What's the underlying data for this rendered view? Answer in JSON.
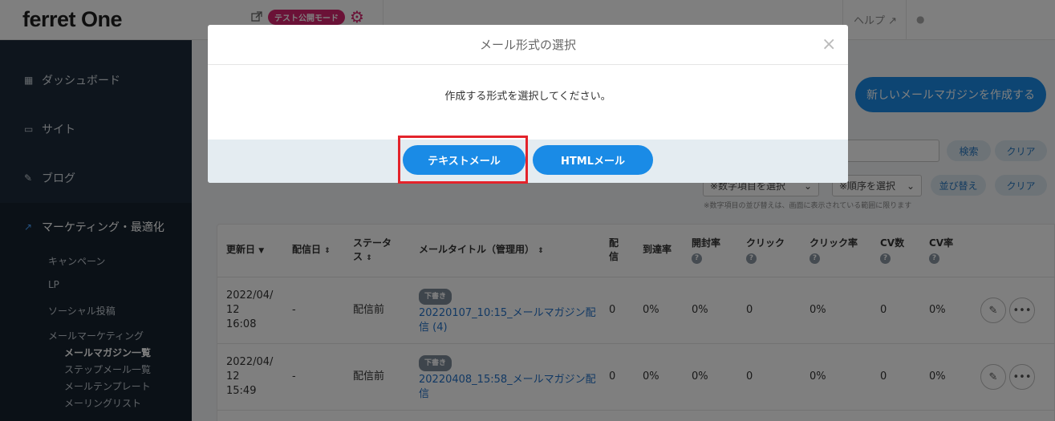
{
  "header": {
    "logo": "ferret One",
    "test_mode_label": "テスト公開モード",
    "help_label": "ヘルプ"
  },
  "sidebar": {
    "items": [
      {
        "label": "ダッシュボード"
      },
      {
        "label": "サイト"
      },
      {
        "label": "ブログ"
      },
      {
        "label": "マーケティング・最適化"
      }
    ],
    "subitems": [
      {
        "label": "キャンペーン"
      },
      {
        "label": "LP"
      },
      {
        "label": "ソーシャル投稿"
      },
      {
        "label": "メールマーケティング"
      }
    ],
    "subsubitems": [
      {
        "label": "メールマガジン一覧"
      },
      {
        "label": "ステップメール一覧"
      },
      {
        "label": "メールテンプレート"
      },
      {
        "label": "メーリングリスト"
      }
    ]
  },
  "main": {
    "new_button": "新しいメールマガジンを作成する",
    "search_button": "検索",
    "clear_button": "クリア",
    "sort_button": "並び替え",
    "sort_select_1": "※数字項目を選択",
    "sort_select_2": "※順序を選択",
    "sort_note": "※数字項目の並び替えは、画面に表示されている範囲に限ります"
  },
  "table": {
    "headers": {
      "updated": "更新日",
      "sent": "配信日",
      "status_1": "ステータ",
      "status_2": "ス",
      "title": "メールタイトル（管理用）",
      "delivery_1": "配",
      "delivery_2": "信",
      "reach": "到達率",
      "open": "開封率",
      "click": "クリック",
      "click_rate": "クリック率",
      "cv": "CV数",
      "cv_rate": "CV率"
    },
    "rows": [
      {
        "updated_1": "2022/04/",
        "updated_2": "12",
        "updated_3": "16:08",
        "sent": "-",
        "status": "配信前",
        "badge": "下書き",
        "title_1": "20220107_10:15_メールマガジン配",
        "title_2": "信 (4)",
        "delivery": "0",
        "reach": "0%",
        "open": "0%",
        "click": "0",
        "click_rate": "0%",
        "cv": "0",
        "cv_rate": "0%"
      },
      {
        "updated_1": "2022/04/",
        "updated_2": "12",
        "updated_3": "15:49",
        "sent": "-",
        "status": "配信前",
        "badge": "下書き",
        "title_1": "20220408_15:58_メールマガジン配",
        "title_2": "信",
        "delivery": "0",
        "reach": "0%",
        "open": "0%",
        "click": "0",
        "click_rate": "0%",
        "cv": "0",
        "cv_rate": "0%"
      }
    ]
  },
  "modal": {
    "title": "メール形式の選択",
    "message": "作成する形式を選択してください。",
    "text_button": "テキストメール",
    "html_button": "HTMLメール"
  },
  "colors": {
    "accent": "#1a8be6",
    "test_mode": "#d6246e",
    "highlight": "#e3232b",
    "sidebar": "#1d2b3a"
  }
}
